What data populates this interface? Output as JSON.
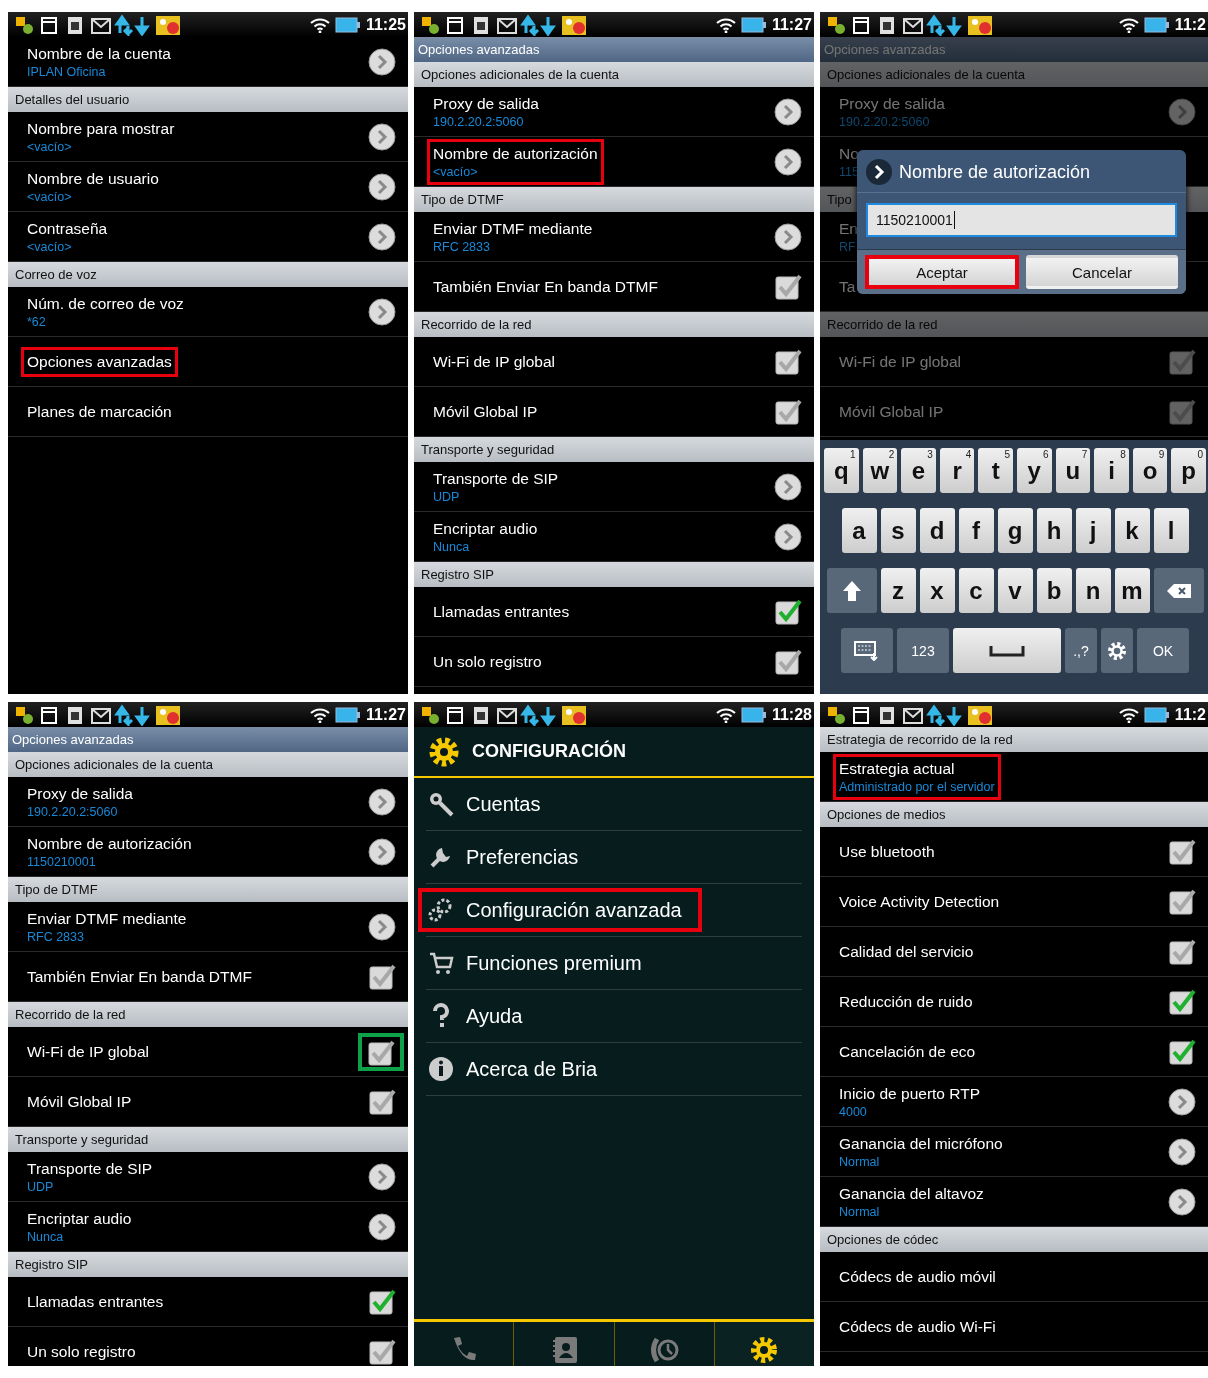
{
  "panels": [
    {
      "kind": "settings",
      "time": "11:25",
      "rows": [
        {
          "kind": "pref",
          "title": "Nombre de la cuenta",
          "summary": "IPLAN Oficina",
          "control": {
            "kind": "arrow"
          }
        },
        {
          "kind": "header",
          "label": "Detalles del usuario"
        },
        {
          "kind": "pref",
          "title": "Nombre para mostrar",
          "summary": "<vacío>",
          "control": {
            "kind": "arrow"
          }
        },
        {
          "kind": "pref",
          "title": "Nombre de usuario",
          "summary": "<vacío>",
          "control": {
            "kind": "arrow"
          }
        },
        {
          "kind": "pref",
          "title": "Contraseña",
          "summary": "<vacío>",
          "control": {
            "kind": "arrow"
          }
        },
        {
          "kind": "header",
          "label": "Correo de voz"
        },
        {
          "kind": "pref",
          "title": "Núm. de correo de voz",
          "summary": "*62",
          "control": {
            "kind": "arrow"
          }
        },
        {
          "kind": "pref",
          "title": "Opciones avanzadas",
          "color": "#e8000f"
        },
        {
          "kind": "pref",
          "title": "Planes de marcación"
        }
      ]
    },
    {
      "kind": "settings",
      "time": "11:27",
      "title": "Opciones avanzadas",
      "rows": [
        {
          "kind": "header",
          "label": "Opciones adicionales de la cuenta"
        },
        {
          "kind": "pref",
          "title": "Proxy de salida",
          "summary": "190.2.20.2:5060",
          "control": {
            "kind": "arrow"
          }
        },
        {
          "kind": "pref",
          "title": "Nombre de autorización",
          "summary": "<vacío>",
          "control": {
            "kind": "arrow"
          },
          "color": "#e8000f"
        },
        {
          "kind": "header",
          "label": "Tipo de DTMF"
        },
        {
          "kind": "pref",
          "title": "Enviar DTMF mediante",
          "summary": "RFC 2833",
          "control": {
            "kind": "arrow"
          }
        },
        {
          "kind": "pref",
          "title": "También Enviar En banda DTMF",
          "control": {
            "kind": "checkbox",
            "checked": false
          }
        },
        {
          "kind": "header",
          "label": "Recorrido de la red"
        },
        {
          "kind": "pref",
          "title": "Wi-Fi de IP global",
          "control": {
            "kind": "checkbox",
            "checked": false
          }
        },
        {
          "kind": "pref",
          "title": "Móvil Global IP",
          "control": {
            "kind": "checkbox",
            "checked": false
          }
        },
        {
          "kind": "header",
          "label": "Transporte y seguridad"
        },
        {
          "kind": "pref",
          "title": "Transporte de SIP",
          "summary": "UDP",
          "control": {
            "kind": "arrow"
          }
        },
        {
          "kind": "pref",
          "title": "Encriptar audio",
          "summary": "Nunca",
          "control": {
            "kind": "arrow"
          }
        },
        {
          "kind": "header",
          "label": "Registro SIP"
        },
        {
          "kind": "pref",
          "title": "Llamadas entrantes",
          "control": {
            "kind": "checkbox",
            "checked": true
          }
        },
        {
          "kind": "pref",
          "title": "Un solo registro",
          "control": {
            "kind": "checkbox",
            "checked": false
          }
        }
      ]
    },
    {
      "kind": "settings",
      "time": "11:2",
      "title": "Opciones avanzadas",
      "dimmed": true,
      "rows": [
        {
          "kind": "header",
          "label": "Opciones adicionales de la cuenta"
        },
        {
          "kind": "pref",
          "title": "Proxy de salida",
          "summary": "190.2.20.2:5060",
          "control": {
            "kind": "arrow"
          }
        },
        {
          "kind": "pref",
          "title": "No",
          "summary": "115"
        },
        {
          "kind": "header",
          "label": "Tipo"
        },
        {
          "kind": "pref",
          "title": "En",
          "summary": "RF"
        },
        {
          "kind": "pref",
          "title": "Ta"
        },
        {
          "kind": "header",
          "label": "Recorrido de la red"
        },
        {
          "kind": "pref",
          "title": "Wi-Fi de IP global",
          "control": {
            "kind": "checkbox",
            "checked": false
          }
        },
        {
          "kind": "pref",
          "title": "Móvil Global IP",
          "control": {
            "kind": "checkbox",
            "checked": false
          }
        }
      ],
      "dialog": {
        "title": "Nombre de autorización",
        "value": "1150210001",
        "buttons": [
          {
            "label": "Aceptar",
            "color": "#e8000f"
          },
          {
            "label": "Cancelar"
          }
        ]
      },
      "keyboard": {
        "rows": [
          {
            "keys": [
              {
                "kind": "char",
                "label": "q",
                "hint": "1"
              },
              {
                "kind": "char",
                "label": "w",
                "hint": "2"
              },
              {
                "kind": "char",
                "label": "e",
                "hint": "3"
              },
              {
                "kind": "char",
                "label": "r",
                "hint": "4"
              },
              {
                "kind": "char",
                "label": "t",
                "hint": "5"
              },
              {
                "kind": "char",
                "label": "y",
                "hint": "6"
              },
              {
                "kind": "char",
                "label": "u",
                "hint": "7"
              },
              {
                "kind": "char",
                "label": "i",
                "hint": "8"
              },
              {
                "kind": "char",
                "label": "o",
                "hint": "9"
              },
              {
                "kind": "char",
                "label": "p",
                "hint": "0"
              }
            ]
          },
          {
            "keys": [
              {
                "kind": "char",
                "label": "a"
              },
              {
                "kind": "char",
                "label": "s"
              },
              {
                "kind": "char",
                "label": "d"
              },
              {
                "kind": "char",
                "label": "f"
              },
              {
                "kind": "char",
                "label": "g"
              },
              {
                "kind": "char",
                "label": "h"
              },
              {
                "kind": "char",
                "label": "j"
              },
              {
                "kind": "char",
                "label": "k"
              },
              {
                "kind": "char",
                "label": "l"
              }
            ]
          },
          {
            "keys": [
              {
                "kind": "shift"
              },
              {
                "kind": "char",
                "label": "z"
              },
              {
                "kind": "char",
                "label": "x"
              },
              {
                "kind": "char",
                "label": "c"
              },
              {
                "kind": "char",
                "label": "v"
              },
              {
                "kind": "char",
                "label": "b"
              },
              {
                "kind": "char",
                "label": "n"
              },
              {
                "kind": "char",
                "label": "m"
              },
              {
                "kind": "backspace"
              }
            ]
          },
          {
            "keys": [
              {
                "kind": "hide"
              },
              {
                "kind": "text",
                "label": "123"
              },
              {
                "kind": "space"
              },
              {
                "kind": "text",
                "label": ".,?"
              },
              {
                "kind": "settings"
              },
              {
                "kind": "text",
                "label": "OK"
              }
            ]
          }
        ]
      }
    },
    {
      "kind": "settings",
      "time": "11:27",
      "title": "Opciones avanzadas",
      "rows": [
        {
          "kind": "header",
          "label": "Opciones adicionales de la cuenta"
        },
        {
          "kind": "pref",
          "title": "Proxy de salida",
          "summary": "190.2.20.2:5060",
          "control": {
            "kind": "arrow"
          }
        },
        {
          "kind": "pref",
          "title": "Nombre de autorización",
          "summary": "1150210001",
          "control": {
            "kind": "arrow"
          }
        },
        {
          "kind": "header",
          "label": "Tipo de DTMF"
        },
        {
          "kind": "pref",
          "title": "Enviar DTMF mediante",
          "summary": "RFC 2833",
          "control": {
            "kind": "arrow"
          }
        },
        {
          "kind": "pref",
          "title": "También Enviar En banda DTMF",
          "control": {
            "kind": "checkbox",
            "checked": false
          }
        },
        {
          "kind": "header",
          "label": "Recorrido de la red"
        },
        {
          "kind": "pref",
          "title": "Wi-Fi de IP global",
          "control": {
            "kind": "checkbox",
            "checked": false,
            "color": "#0fa04a"
          }
        },
        {
          "kind": "pref",
          "title": "Móvil Global IP",
          "control": {
            "kind": "checkbox",
            "checked": false
          }
        },
        {
          "kind": "header",
          "label": "Transporte y seguridad"
        },
        {
          "kind": "pref",
          "title": "Transporte de SIP",
          "summary": "UDP",
          "control": {
            "kind": "arrow"
          }
        },
        {
          "kind": "pref",
          "title": "Encriptar audio",
          "summary": "Nunca",
          "control": {
            "kind": "arrow"
          }
        },
        {
          "kind": "header",
          "label": "Registro SIP"
        },
        {
          "kind": "pref",
          "title": "Llamadas entrantes",
          "control": {
            "kind": "checkbox",
            "checked": true
          }
        },
        {
          "kind": "pref",
          "title": "Un solo registro",
          "control": {
            "kind": "checkbox",
            "checked": false
          }
        }
      ]
    },
    {
      "kind": "menu",
      "time": "11:28",
      "title": "CONFIGURACIÓN",
      "items": [
        {
          "label": "Cuentas"
        },
        {
          "label": "Preferencias"
        },
        {
          "label": "Configuración avanzada",
          "color": "#e8000f"
        },
        {
          "label": "Funciones premium"
        },
        {
          "label": "Ayuda"
        },
        {
          "label": "Acerca de Bria"
        }
      ],
      "tabs": [
        {
          "selected": false
        },
        {
          "selected": false
        },
        {
          "selected": false
        },
        {
          "selected": true
        }
      ]
    },
    {
      "kind": "settings",
      "time": "11:2",
      "rows": [
        {
          "kind": "header",
          "label": "Estrategia de recorrido de la red"
        },
        {
          "kind": "pref",
          "title": "Estrategia actual",
          "summary": "Administrado por el servidor",
          "color": "#e8000f"
        },
        {
          "kind": "header",
          "label": "Opciones de medios"
        },
        {
          "kind": "pref",
          "title": "Use bluetooth",
          "control": {
            "kind": "checkbox",
            "checked": false
          }
        },
        {
          "kind": "pref",
          "title": "Voice Activity Detection",
          "control": {
            "kind": "checkbox",
            "checked": false
          }
        },
        {
          "kind": "pref",
          "title": "Calidad del servicio",
          "control": {
            "kind": "checkbox",
            "checked": false
          }
        },
        {
          "kind": "pref",
          "title": "Reducción de ruido",
          "control": {
            "kind": "checkbox",
            "checked": true
          }
        },
        {
          "kind": "pref",
          "title": "Cancelación de eco",
          "control": {
            "kind": "checkbox",
            "checked": true
          }
        },
        {
          "kind": "pref",
          "title": "Inicio de puerto RTP",
          "summary": "4000",
          "control": {
            "kind": "arrow"
          }
        },
        {
          "kind": "pref",
          "title": "Ganancia del micrófono",
          "summary": "Normal",
          "control": {
            "kind": "arrow"
          }
        },
        {
          "kind": "pref",
          "title": "Ganancia del altavoz",
          "summary": "Normal",
          "control": {
            "kind": "arrow"
          }
        },
        {
          "kind": "header",
          "label": "Opciones de códec"
        },
        {
          "kind": "pref",
          "title": "Códecs de audio móvil"
        },
        {
          "kind": "pref",
          "title": "Códecs de audio Wi-Fi"
        }
      ]
    }
  ]
}
